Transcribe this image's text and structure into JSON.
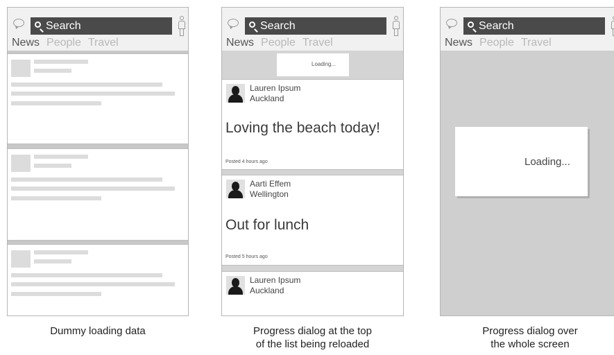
{
  "search": {
    "label": "Search"
  },
  "tabs": [
    "News",
    "People",
    "Travel"
  ],
  "panel2": {
    "loading_label": "Loading...",
    "posts": [
      {
        "name": "Lauren Ipsum",
        "city": "Auckland",
        "text": "Loving the beach today!",
        "time": "Posted 4 hours ago"
      },
      {
        "name": "Aarti Effem",
        "city": "Wellington",
        "text": "Out for lunch",
        "time": "Posted 5 hours ago"
      },
      {
        "name": "Lauren Ipsum",
        "city": "Auckland"
      }
    ]
  },
  "panel3": {
    "loading_label": "Loading..."
  },
  "captions": {
    "panel1": [
      "Dummy loading data"
    ],
    "panel2": [
      "Progress dialog at the top",
      "of the list being reloaded"
    ],
    "panel3": [
      "Progress dialog over",
      "the whole screen"
    ]
  }
}
